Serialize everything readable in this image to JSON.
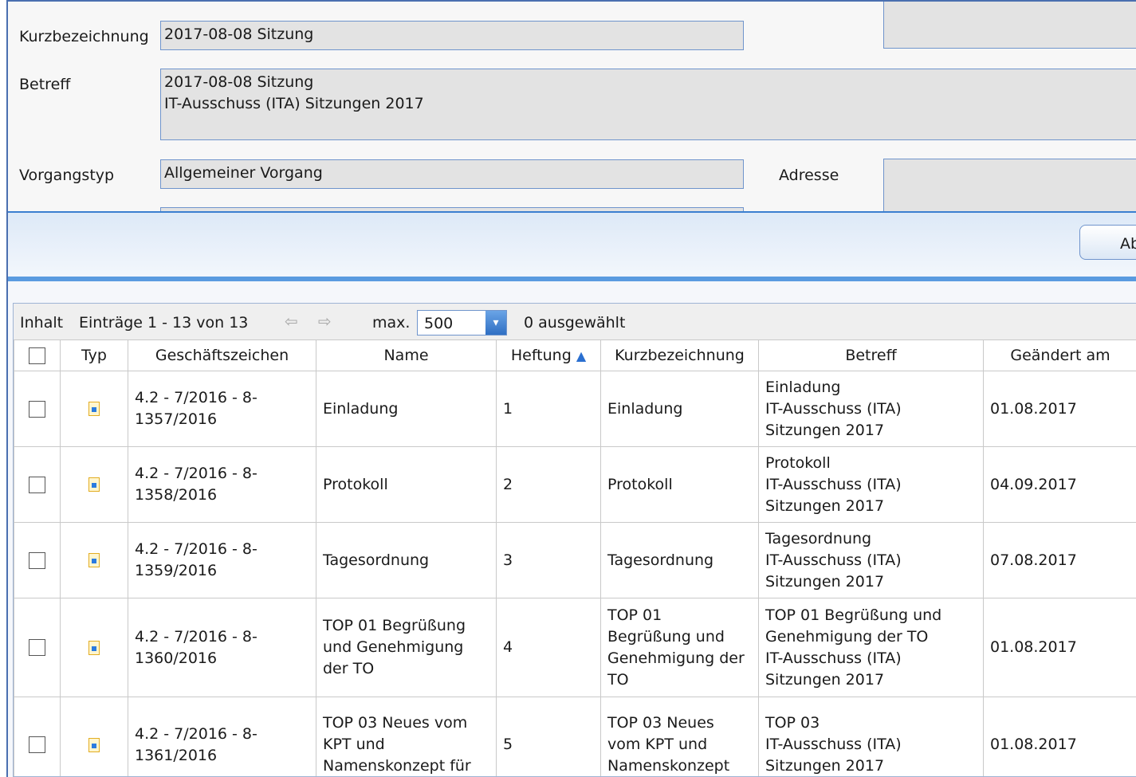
{
  "form": {
    "kurzbezeichnung_label": "Kurzbezeichnung",
    "kurzbezeichnung_value": "2017-08-08 Sitzung",
    "betreff_label": "Betreff",
    "betreff_value": "2017-08-08 Sitzung\nIT-Ausschuss (ITA) Sitzungen 2017",
    "vorgangstyp_label": "Vorgangstyp",
    "vorgangstyp_value": "Allgemeiner Vorgang",
    "adresse_label": "Adresse",
    "adresse_value": ""
  },
  "band": {
    "button_label": "Ab"
  },
  "grid": {
    "inhalt_label": "Inhalt",
    "entries_text": "Einträge 1 - 13 von 13",
    "max_label": "max.",
    "max_value": "500",
    "selected_text": "0 ausgewählt",
    "columns": [
      "Typ",
      "Geschäftszeichen",
      "Name",
      "Heftung",
      "Kurzbezeichnung",
      "Betreff",
      "Geändert am"
    ],
    "sort_indicator": "▲",
    "rows": [
      {
        "geschaeftszeichen": "4.2 - 7/2016 - 8-\n1357/2016",
        "name": "Einladung",
        "heftung": "1",
        "kurzbezeichnung": "Einladung",
        "betreff": "Einladung\nIT-Ausschuss (ITA)\nSitzungen 2017",
        "geaendert": "01.08.2017"
      },
      {
        "geschaeftszeichen": "4.2 - 7/2016 - 8-\n1358/2016",
        "name": "Protokoll",
        "heftung": "2",
        "kurzbezeichnung": "Protokoll",
        "betreff": "Protokoll\nIT-Ausschuss (ITA)\nSitzungen 2017",
        "geaendert": "04.09.2017"
      },
      {
        "geschaeftszeichen": "4.2 - 7/2016 - 8-\n1359/2016",
        "name": "Tagesordnung",
        "heftung": "3",
        "kurzbezeichnung": "Tagesordnung",
        "betreff": "Tagesordnung\nIT-Ausschuss (ITA)\nSitzungen 2017",
        "geaendert": "07.08.2017"
      },
      {
        "geschaeftszeichen": "4.2 - 7/2016 - 8-\n1360/2016",
        "name": "TOP 01 Begrüßung\nund Genehmigung\nder TO",
        "heftung": "4",
        "kurzbezeichnung": "TOP 01\nBegrüßung und\nGenehmigung der\nTO",
        "betreff": "TOP 01 Begrüßung und\nGenehmigung der TO\nIT-Ausschuss (ITA)\nSitzungen 2017",
        "geaendert": "01.08.2017"
      },
      {
        "geschaeftszeichen": "4.2 - 7/2016 - 8-\n1361/2016",
        "name": "TOP 03 Neues vom\nKPT und\nNamenskonzept für",
        "heftung": "5",
        "kurzbezeichnung": "TOP 03 Neues\nvom KPT und\nNamenskonzept",
        "betreff": "TOP 03\nIT-Ausschuss (ITA)\nSitzungen 2017",
        "geaendert": "01.08.2017"
      }
    ]
  }
}
